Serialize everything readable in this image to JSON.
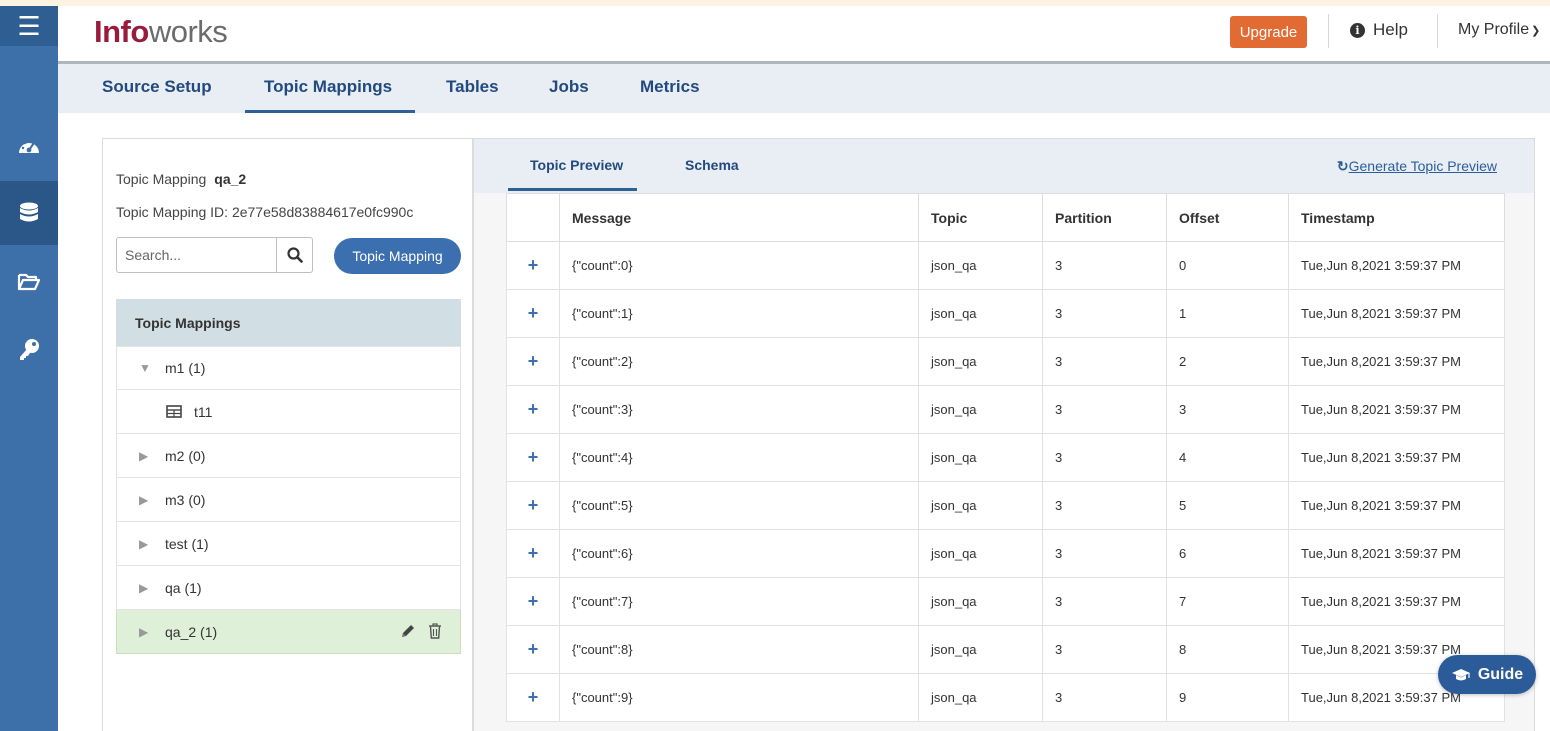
{
  "header": {
    "logo_part1": "Info",
    "logo_part2": "works",
    "upgrade_label": "Upgrade",
    "help_label": "Help",
    "profile_label": "My Profile"
  },
  "sidebar": {
    "items": [
      {
        "icon": "dashboard-icon"
      },
      {
        "icon": "database-icon",
        "active": true
      },
      {
        "icon": "folder-open-icon"
      },
      {
        "icon": "key-icon"
      }
    ]
  },
  "tabs": [
    {
      "label": "Source Setup"
    },
    {
      "label": "Topic Mappings",
      "active": true
    },
    {
      "label": "Tables"
    },
    {
      "label": "Jobs"
    },
    {
      "label": "Metrics"
    }
  ],
  "left_panel": {
    "topic_mapping_label": "Topic Mapping",
    "topic_mapping_name": "qa_2",
    "topic_mapping_id": "Topic Mapping ID: 2e77e58d83884617e0fc990c",
    "search_placeholder": "Search...",
    "add_button_label": "Topic Mapping",
    "tree_header": "Topic Mappings",
    "tree": [
      {
        "label": "m1 (1)",
        "expanded": true,
        "children": [
          {
            "label": "t11"
          }
        ]
      },
      {
        "label": "m2 (0)"
      },
      {
        "label": "m3 (0)"
      },
      {
        "label": "test (1)"
      },
      {
        "label": "qa (1)"
      },
      {
        "label": "qa_2 (1)",
        "selected": true
      }
    ]
  },
  "right_panel": {
    "tabs": [
      {
        "label": "Topic Preview",
        "active": true
      },
      {
        "label": "Schema"
      }
    ],
    "generate_link": "Generate Topic Preview",
    "columns": [
      "",
      "Message",
      "Topic",
      "Partition",
      "Offset",
      "Timestamp"
    ],
    "expand_symbol": "+",
    "rows": [
      {
        "message": "{\"count\":0}",
        "topic": "json_qa",
        "partition": "3",
        "offset": "0",
        "timestamp": "Tue,Jun 8,2021 3:59:37 PM"
      },
      {
        "message": "{\"count\":1}",
        "topic": "json_qa",
        "partition": "3",
        "offset": "1",
        "timestamp": "Tue,Jun 8,2021 3:59:37 PM"
      },
      {
        "message": "{\"count\":2}",
        "topic": "json_qa",
        "partition": "3",
        "offset": "2",
        "timestamp": "Tue,Jun 8,2021 3:59:37 PM"
      },
      {
        "message": "{\"count\":3}",
        "topic": "json_qa",
        "partition": "3",
        "offset": "3",
        "timestamp": "Tue,Jun 8,2021 3:59:37 PM"
      },
      {
        "message": "{\"count\":4}",
        "topic": "json_qa",
        "partition": "3",
        "offset": "4",
        "timestamp": "Tue,Jun 8,2021 3:59:37 PM"
      },
      {
        "message": "{\"count\":5}",
        "topic": "json_qa",
        "partition": "3",
        "offset": "5",
        "timestamp": "Tue,Jun 8,2021 3:59:37 PM"
      },
      {
        "message": "{\"count\":6}",
        "topic": "json_qa",
        "partition": "3",
        "offset": "6",
        "timestamp": "Tue,Jun 8,2021 3:59:37 PM"
      },
      {
        "message": "{\"count\":7}",
        "topic": "json_qa",
        "partition": "3",
        "offset": "7",
        "timestamp": "Tue,Jun 8,2021 3:59:37 PM"
      },
      {
        "message": "{\"count\":8}",
        "topic": "json_qa",
        "partition": "3",
        "offset": "8",
        "timestamp": "Tue,Jun 8,2021 3:59:37 PM"
      },
      {
        "message": "{\"count\":9}",
        "topic": "json_qa",
        "partition": "3",
        "offset": "9",
        "timestamp": "Tue,Jun 8,2021 3:59:37 PM"
      }
    ]
  },
  "guide_label": "Guide",
  "colors": {
    "rail": "#3d6fa8",
    "accent": "#2e5f95",
    "upgrade": "#e26a33",
    "logo_red": "#9a1c3c",
    "selected_row": "#dff0d8"
  }
}
